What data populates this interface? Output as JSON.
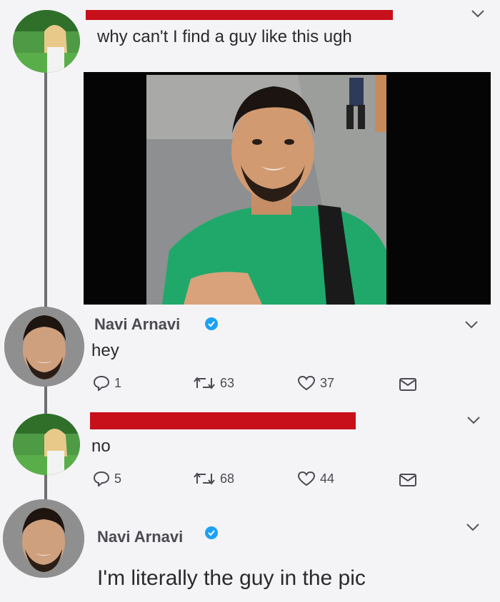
{
  "tweets": [
    {
      "author_redacted": true,
      "text": "why can't I find a guy like this ugh"
    },
    {
      "name": "Navi Arnavi",
      "verified": true,
      "text": "hey",
      "actions": {
        "replies": "1",
        "retweets": "63",
        "likes": "37"
      }
    },
    {
      "author_redacted": true,
      "text": "no",
      "actions": {
        "replies": "5",
        "retweets": "68",
        "likes": "44"
      }
    },
    {
      "name": "Navi Arnavi",
      "verified": true,
      "text": "I'm literally the guy in the pic"
    }
  ],
  "colors": {
    "background": "#f4f4f6",
    "redaction": "#c8101a",
    "verified": "#1da1f2",
    "thread_line": "#6e6e73",
    "shirt": "#1fa86a"
  },
  "icons": [
    "chevron-down-icon",
    "reply-icon",
    "retweet-icon",
    "like-icon",
    "message-icon",
    "verified-icon"
  ]
}
